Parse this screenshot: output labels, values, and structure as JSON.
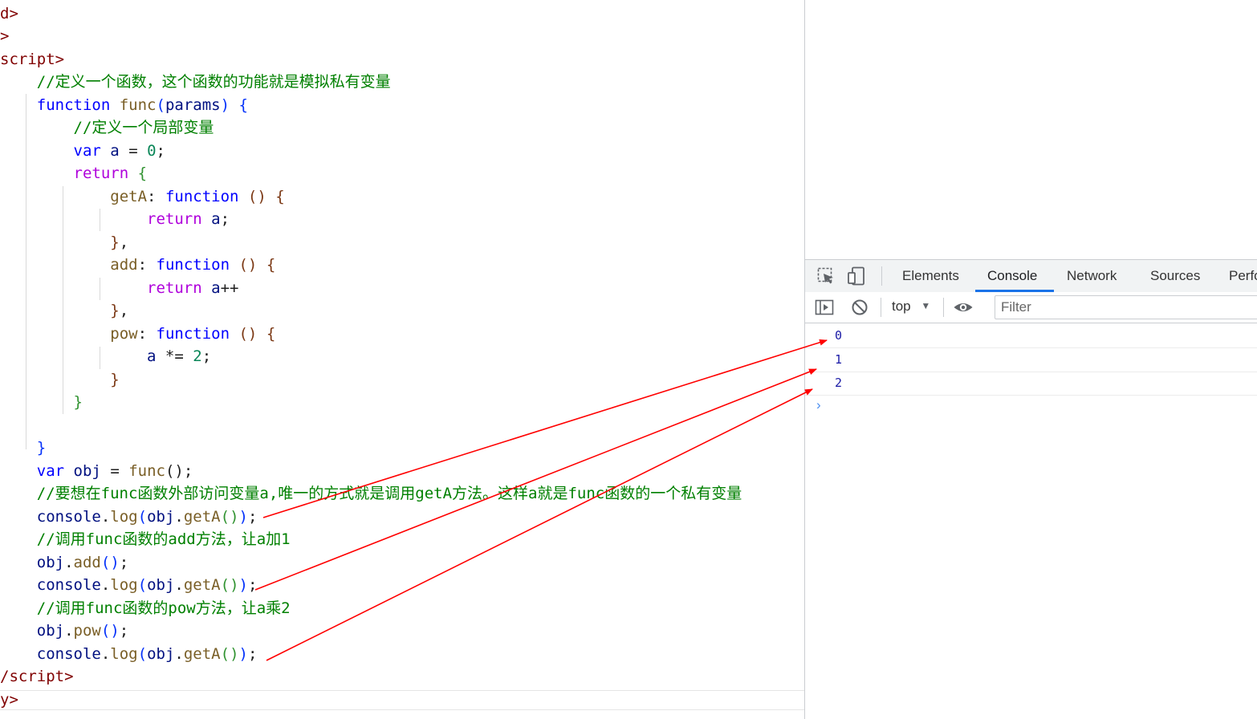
{
  "editor": {
    "lines": [
      [
        [
          "d>",
          "tag"
        ]
      ],
      [
        [
          ">",
          "tag"
        ]
      ],
      [
        [
          "script>",
          "tag"
        ]
      ],
      [
        [
          "    ",
          "pl"
        ],
        [
          "//定义一个函数，这个函数的功能就是模拟私有变量",
          "cm"
        ]
      ],
      [
        [
          "    ",
          "pl"
        ],
        [
          "function",
          "kw"
        ],
        [
          " ",
          "pl"
        ],
        [
          "func",
          "fn"
        ],
        [
          "(",
          "br1"
        ],
        [
          "params",
          "var"
        ],
        [
          ")",
          "br1"
        ],
        [
          " ",
          "pl"
        ],
        [
          "{",
          "br1"
        ]
      ],
      [
        [
          "        ",
          "pl"
        ],
        [
          "//定义一个局部变量",
          "cm"
        ]
      ],
      [
        [
          "        ",
          "pl"
        ],
        [
          "var",
          "kw"
        ],
        [
          " ",
          "pl"
        ],
        [
          "a",
          "var"
        ],
        [
          " = ",
          "pl"
        ],
        [
          "0",
          "num"
        ],
        [
          ";",
          "pl"
        ]
      ],
      [
        [
          "        ",
          "pl"
        ],
        [
          "return",
          "kw2"
        ],
        [
          " ",
          "pl"
        ],
        [
          "{",
          "br2"
        ]
      ],
      [
        [
          "            ",
          "pl"
        ],
        [
          "getA",
          "fn"
        ],
        [
          ": ",
          "pl"
        ],
        [
          "function",
          "kw"
        ],
        [
          " ",
          "pl"
        ],
        [
          "()",
          "br3"
        ],
        [
          " ",
          "pl"
        ],
        [
          "{",
          "br3"
        ]
      ],
      [
        [
          "                ",
          "pl"
        ],
        [
          "return",
          "kw2"
        ],
        [
          " ",
          "pl"
        ],
        [
          "a",
          "var"
        ],
        [
          ";",
          "pl"
        ]
      ],
      [
        [
          "            ",
          "pl"
        ],
        [
          "}",
          "br3"
        ],
        [
          ",",
          "pl"
        ]
      ],
      [
        [
          "            ",
          "pl"
        ],
        [
          "add",
          "fn"
        ],
        [
          ": ",
          "pl"
        ],
        [
          "function",
          "kw"
        ],
        [
          " ",
          "pl"
        ],
        [
          "()",
          "br3"
        ],
        [
          " ",
          "pl"
        ],
        [
          "{",
          "br3"
        ]
      ],
      [
        [
          "                ",
          "pl"
        ],
        [
          "return",
          "kw2"
        ],
        [
          " ",
          "pl"
        ],
        [
          "a",
          "var"
        ],
        [
          "++",
          "pl"
        ]
      ],
      [
        [
          "            ",
          "pl"
        ],
        [
          "}",
          "br3"
        ],
        [
          ",",
          "pl"
        ]
      ],
      [
        [
          "            ",
          "pl"
        ],
        [
          "pow",
          "fn"
        ],
        [
          ": ",
          "pl"
        ],
        [
          "function",
          "kw"
        ],
        [
          " ",
          "pl"
        ],
        [
          "()",
          "br3"
        ],
        [
          " ",
          "pl"
        ],
        [
          "{",
          "br3"
        ]
      ],
      [
        [
          "                ",
          "pl"
        ],
        [
          "a",
          "var"
        ],
        [
          " *= ",
          "pl"
        ],
        [
          "2",
          "num"
        ],
        [
          ";",
          "pl"
        ]
      ],
      [
        [
          "            ",
          "pl"
        ],
        [
          "}",
          "br3"
        ]
      ],
      [
        [
          "        ",
          "pl"
        ],
        [
          "}",
          "br2"
        ]
      ],
      [
        [
          "",
          "pl"
        ]
      ],
      [
        [
          "    ",
          "pl"
        ],
        [
          "}",
          "br1"
        ]
      ],
      [
        [
          "    ",
          "pl"
        ],
        [
          "var",
          "kw"
        ],
        [
          " ",
          "pl"
        ],
        [
          "obj",
          "var"
        ],
        [
          " = ",
          "pl"
        ],
        [
          "func",
          "fn"
        ],
        [
          "();",
          "pl"
        ]
      ],
      [
        [
          "    ",
          "pl"
        ],
        [
          "//要想在func函数外部访问变量a,唯一的方式就是调用getA方法。这样a就是func函数的一个私有变量",
          "cm"
        ]
      ],
      [
        [
          "    ",
          "pl"
        ],
        [
          "console",
          "var"
        ],
        [
          ".",
          "pl"
        ],
        [
          "log",
          "fn"
        ],
        [
          "(",
          "br1"
        ],
        [
          "obj",
          "var"
        ],
        [
          ".",
          "pl"
        ],
        [
          "getA",
          "fn"
        ],
        [
          "()",
          "br2"
        ],
        [
          ")",
          "br1"
        ],
        [
          ";",
          "pl"
        ]
      ],
      [
        [
          "    ",
          "pl"
        ],
        [
          "//调用func函数的add方法，让a加1",
          "cm"
        ]
      ],
      [
        [
          "    ",
          "pl"
        ],
        [
          "obj",
          "var"
        ],
        [
          ".",
          "pl"
        ],
        [
          "add",
          "fn"
        ],
        [
          "()",
          "br1"
        ],
        [
          ";",
          "pl"
        ]
      ],
      [
        [
          "    ",
          "pl"
        ],
        [
          "console",
          "var"
        ],
        [
          ".",
          "pl"
        ],
        [
          "log",
          "fn"
        ],
        [
          "(",
          "br1"
        ],
        [
          "obj",
          "var"
        ],
        [
          ".",
          "pl"
        ],
        [
          "getA",
          "fn"
        ],
        [
          "()",
          "br2"
        ],
        [
          ")",
          "br1"
        ],
        [
          ";",
          "pl"
        ]
      ],
      [
        [
          "    ",
          "pl"
        ],
        [
          "//调用func函数的pow方法，让a乘2",
          "cm"
        ]
      ],
      [
        [
          "    ",
          "pl"
        ],
        [
          "obj",
          "var"
        ],
        [
          ".",
          "pl"
        ],
        [
          "pow",
          "fn"
        ],
        [
          "()",
          "br1"
        ],
        [
          ";",
          "pl"
        ]
      ],
      [
        [
          "    ",
          "pl"
        ],
        [
          "console",
          "var"
        ],
        [
          ".",
          "pl"
        ],
        [
          "log",
          "fn"
        ],
        [
          "(",
          "br1"
        ],
        [
          "obj",
          "var"
        ],
        [
          ".",
          "pl"
        ],
        [
          "getA",
          "fn"
        ],
        [
          "()",
          "br2"
        ],
        [
          ")",
          "br1"
        ],
        [
          ";",
          "pl"
        ]
      ],
      [
        [
          "/script>",
          "tag"
        ]
      ],
      [
        [
          "y>",
          "tag"
        ]
      ]
    ]
  },
  "devtools": {
    "tabs": [
      "Elements",
      "Console",
      "Network",
      "Sources",
      "Perfo"
    ],
    "active_tab": "Console",
    "context": "top",
    "context_arrow": "▼",
    "filter_placeholder": "Filter",
    "messages": [
      "0",
      "1",
      "2"
    ],
    "prompt": "›"
  },
  "colors": {
    "tag": "#800000",
    "comment": "#008000",
    "keyword": "#0000ff",
    "control": "#af00db",
    "function": "#795e26",
    "variable": "#001080",
    "number": "#098658",
    "annotation_arrow": "#ff0000",
    "accent": "#1a73e8"
  }
}
